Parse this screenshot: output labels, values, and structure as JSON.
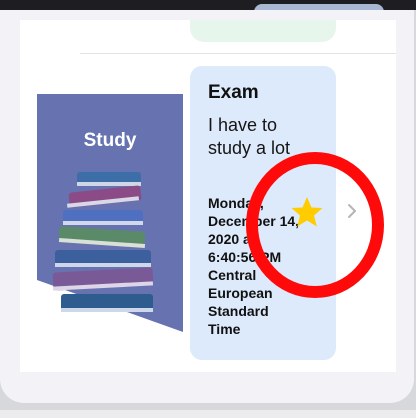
{
  "message": {
    "title": "Exam",
    "body": "I have to study a lot",
    "date": "Monday, December 14, 2020 at 6:40:56 PM Central European Standard Time"
  },
  "thumbnail": {
    "label": "Study"
  },
  "icons": {
    "favorite": "star-icon",
    "disclosure": "chevron-right-icon"
  },
  "colors": {
    "bubble": "#ddeafb",
    "star": "#ffcc00",
    "annotation_ring": "#ff0a0a",
    "thumbnail_bg": "#6673b0"
  }
}
